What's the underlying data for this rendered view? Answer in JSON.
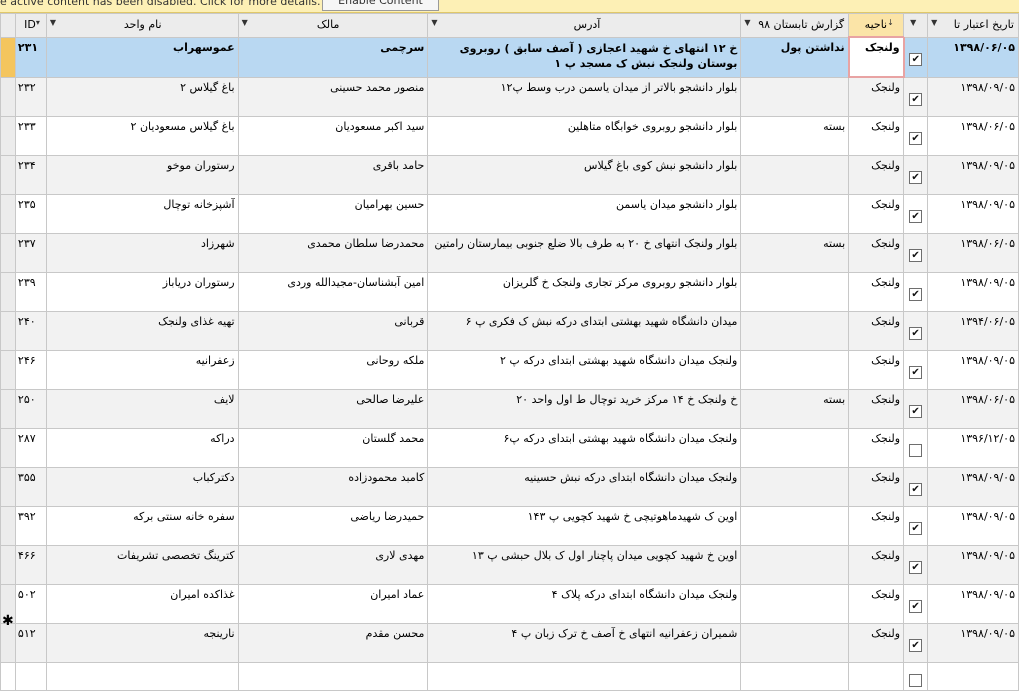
{
  "message_bar": {
    "text": "e active content has been disabled. Click for more details.",
    "button": "Enable Content"
  },
  "columns": {
    "id": "ID",
    "unit_name": "نام واحد",
    "owner": "مالک",
    "address": "آدرس",
    "summer_report": "گزارش تابستان ۹۸",
    "district": "ناحیه",
    "validity_date": "تاریخ اعتبار تا"
  },
  "rows": [
    {
      "id": "۲۳۱",
      "unit": "عموسهراب",
      "owner": "سرچمی",
      "address": "خ ۱۲ انتهای خ شهید اعجازی ( آصف سابق ) روبروی بوستان ولنجک نبش ک مسجد پ ۱",
      "report": "نداشتن پول",
      "district": "ولنجک",
      "checked": true,
      "date": "۱۳۹۸/۰۶/۰۵"
    },
    {
      "id": "۲۳۲",
      "unit": "باغ گیلاس ۲",
      "owner": "منصور محمد حسینی",
      "address": "بلوار دانشجو بالاتر از میدان یاسمن درب وسط پ۱۲",
      "report": "",
      "district": "ولنجک",
      "checked": true,
      "date": "۱۳۹۸/۰۹/۰۵"
    },
    {
      "id": "۲۳۳",
      "unit": "باغ گیلاس مسعودیان ۲",
      "owner": "سید اکبر مسعودیان",
      "address": "بلوار دانشجو روبروی خوابگاه متاهلین",
      "report": "بسته",
      "district": "ولنجک",
      "checked": true,
      "date": "۱۳۹۸/۰۶/۰۵"
    },
    {
      "id": "۲۳۴",
      "unit": "رستوران موخو",
      "owner": "حامد باقری",
      "address": "بلوار دانشجو  نبش کوی باغ گیلاس",
      "report": "",
      "district": "ولنجک",
      "checked": true,
      "date": "۱۳۹۸/۰۹/۰۵"
    },
    {
      "id": "۲۳۵",
      "unit": "آشپزخانه توچال",
      "owner": "حسین بهرامیان",
      "address": "بلوار دانشجو  میدان یاسمن",
      "report": "",
      "district": "ولنجک",
      "checked": true,
      "date": "۱۳۹۸/۰۹/۰۵"
    },
    {
      "id": "۲۳۷",
      "unit": "شهرزاد",
      "owner": "محمدرضا سلطان محمدی",
      "address": "بلوار ولنجک انتهای خ ۲۰ به طرف بالا ضلع جنوبی بیمارستان رامتین",
      "report": "بسته",
      "district": "ولنجک",
      "checked": true,
      "date": "۱۳۹۸/۰۶/۰۵"
    },
    {
      "id": "۲۳۹",
      "unit": "رستوران دریاباز",
      "owner": "امین آبشناسان-مجیدالله وردی",
      "address": "بلوار دانشجو روبروی مرکز تجاری ولنجک خ گلریزان",
      "report": "",
      "district": "ولنجک",
      "checked": true,
      "date": "۱۳۹۸/۰۹/۰۵"
    },
    {
      "id": "۲۴۰",
      "unit": "تهیه غذای ولنجک",
      "owner": "قربانی",
      "address": "میدان دانشگاه شهید بهشتی ابتدای درکه نبش ک فکری پ ۶",
      "report": "",
      "district": "ولنجک",
      "checked": true,
      "date": "۱۳۹۴/۰۶/۰۵"
    },
    {
      "id": "۲۴۶",
      "unit": "زعفرانیه",
      "owner": "ملکه روحانی",
      "address": "ولنجک میدان دانشگاه شهید بهشتی ابتدای درکه پ ۲",
      "report": "",
      "district": "ولنجک",
      "checked": true,
      "date": "۱۳۹۸/۰۹/۰۵"
    },
    {
      "id": "۲۵۰",
      "unit": "لایف",
      "owner": "علیرضا صالحی",
      "address": "خ ولنجک خ ۱۴ مرکز خرید توچال ط اول واحد ۲۰",
      "report": "بسته",
      "district": "ولنجک",
      "checked": true,
      "date": "۱۳۹۸/۰۶/۰۵"
    },
    {
      "id": "۲۸۷",
      "unit": "دراکه",
      "owner": "محمد گلستان",
      "address": "ولنجک میدان دانشگاه شهید بهشتی ابتدای درکه پ۶",
      "report": "",
      "district": "ولنجک",
      "checked": false,
      "date": "۱۳۹۶/۱۲/۰۵"
    },
    {
      "id": "۳۵۵",
      "unit": "دکترکباب",
      "owner": "کامبد محمودزاده",
      "address": "ولنجک میدان دانشگاه ابتدای درکه نبش حسینیه",
      "report": "",
      "district": "ولنجک",
      "checked": true,
      "date": "۱۳۹۸/۰۹/۰۵"
    },
    {
      "id": "۳۹۲",
      "unit": "سفره خانه سنتی برکه",
      "owner": "حمیدرضا ریاضی",
      "address": "اوین ک شهیدماهوتیچی خ شهید کچویی پ ۱۴۳",
      "report": "",
      "district": "ولنجک",
      "checked": true,
      "date": "۱۳۹۸/۰۹/۰۵"
    },
    {
      "id": "۴۶۶",
      "unit": "کترینگ تخصصی تشریفات",
      "owner": "مهدی لاری",
      "address": "اوین خ شهید کچویی میدان پاچنار اول ک بلال حبشی پ ۱۳",
      "report": "",
      "district": "ولنجک",
      "checked": true,
      "date": "۱۳۹۸/۰۹/۰۵"
    },
    {
      "id": "۵۰۲",
      "unit": "غذاکده امیران",
      "owner": "عماد امیران",
      "address": "ولنجک میدان دانشگاه ابتدای درکه پلاک ۴",
      "report": "",
      "district": "ولنجک",
      "checked": true,
      "date": "۱۳۹۸/۰۹/۰۵"
    },
    {
      "id": "۵۱۲",
      "unit": "نارینجه",
      "owner": "محسن مقدم",
      "address": "شمیران زعفرانیه انتهای خ آصف خ ترک زبان پ ۴",
      "report": "",
      "district": "ولنجک",
      "checked": true,
      "date": "۱۳۹۸/۰۹/۰۵"
    }
  ]
}
